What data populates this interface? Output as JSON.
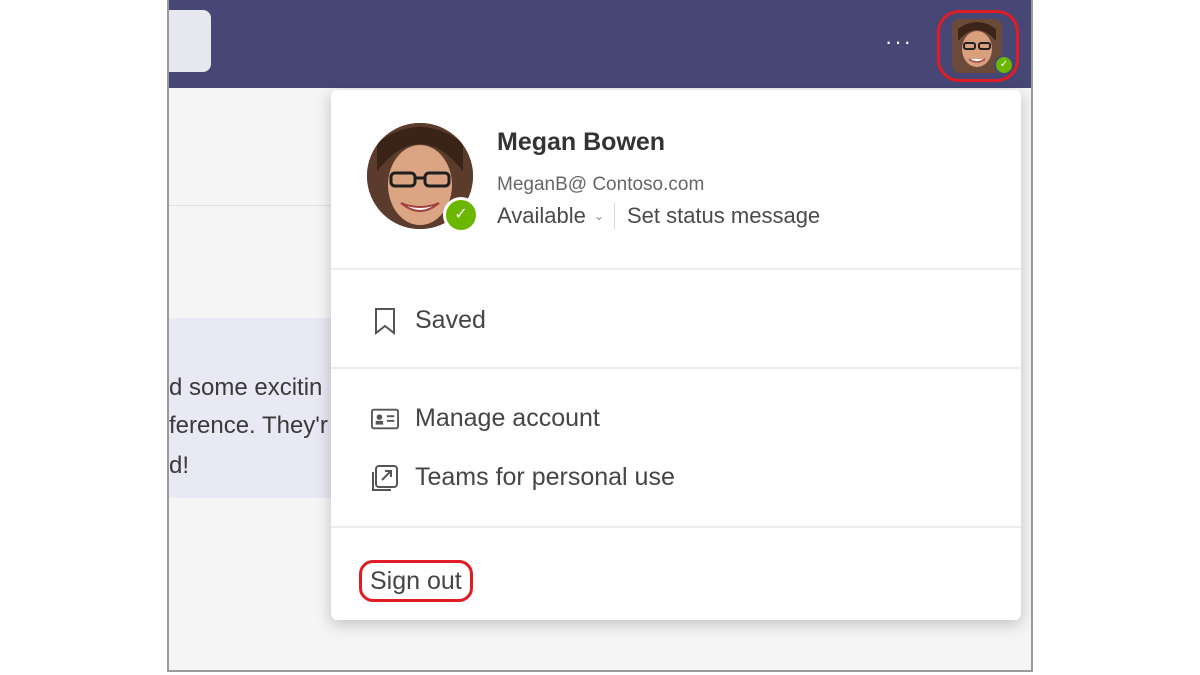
{
  "header": {
    "more_label": "···",
    "avatar_icon": "user-avatar-photo",
    "presence_icon": "check-icon"
  },
  "background": {
    "message_lines": [
      "d some excitin",
      "ference. They'r",
      "d!"
    ]
  },
  "profile": {
    "name": "Megan Bowen",
    "email": "MeganB@ Contoso.com",
    "status": "Available",
    "status_chevron": "⌄",
    "set_status_label": "Set status message"
  },
  "menu": {
    "saved_label": "Saved",
    "manage_account_label": "Manage account",
    "personal_use_label": "Teams for personal use",
    "sign_out_label": "Sign out"
  },
  "colors": {
    "topbar": "#464775",
    "presence": "#6bb700",
    "highlight": "#e01c24"
  }
}
